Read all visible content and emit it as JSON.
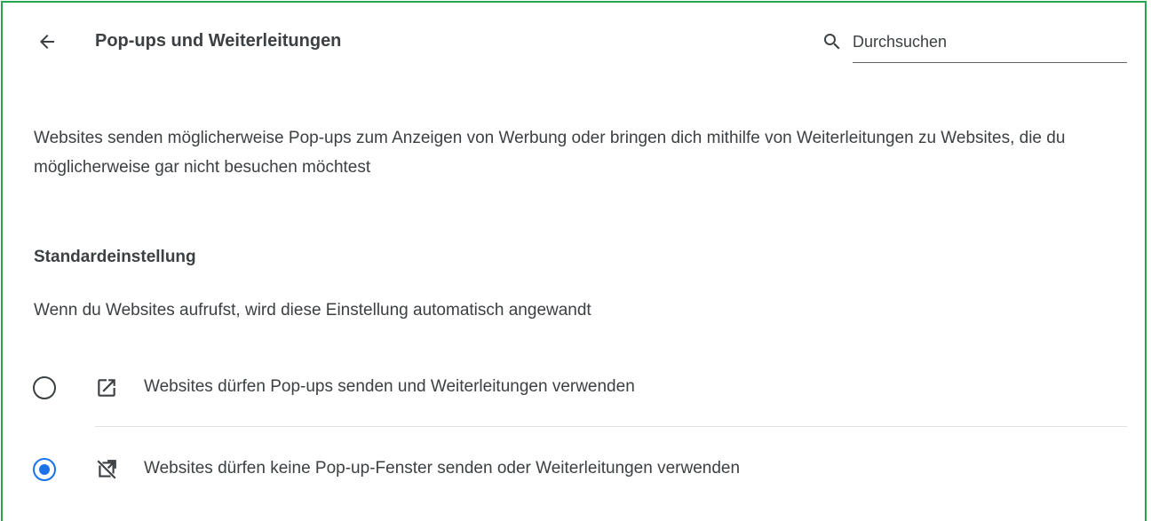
{
  "header": {
    "title": "Pop-ups und Weiterleitungen",
    "back_icon": "arrow-back-icon",
    "search": {
      "placeholder": "Durchsuchen",
      "value": "",
      "icon": "search-icon"
    }
  },
  "description": "Websites senden möglicherweise Pop-ups zum Anzeigen von Werbung oder bringen dich mithilfe von Weiterleitungen zu Websites, die du möglicherweise gar nicht besuchen möchtest",
  "default_section": {
    "heading": "Standardeinstellung",
    "subtext": "Wenn du Websites aufrufst, wird diese Einstellung automatisch angewandt",
    "options": [
      {
        "label": "Websites dürfen Pop-ups senden und Weiterleitungen verwenden",
        "icon": "open-in-new-icon",
        "selected": false
      },
      {
        "label": "Websites dürfen keine Pop-up-Fenster senden oder Weiterleitungen verwenden",
        "icon": "open-in-new-off-icon",
        "selected": true
      }
    ]
  },
  "colors": {
    "frame_border": "#22a94f",
    "accent": "#1a73e8",
    "text": "#3c4043"
  }
}
